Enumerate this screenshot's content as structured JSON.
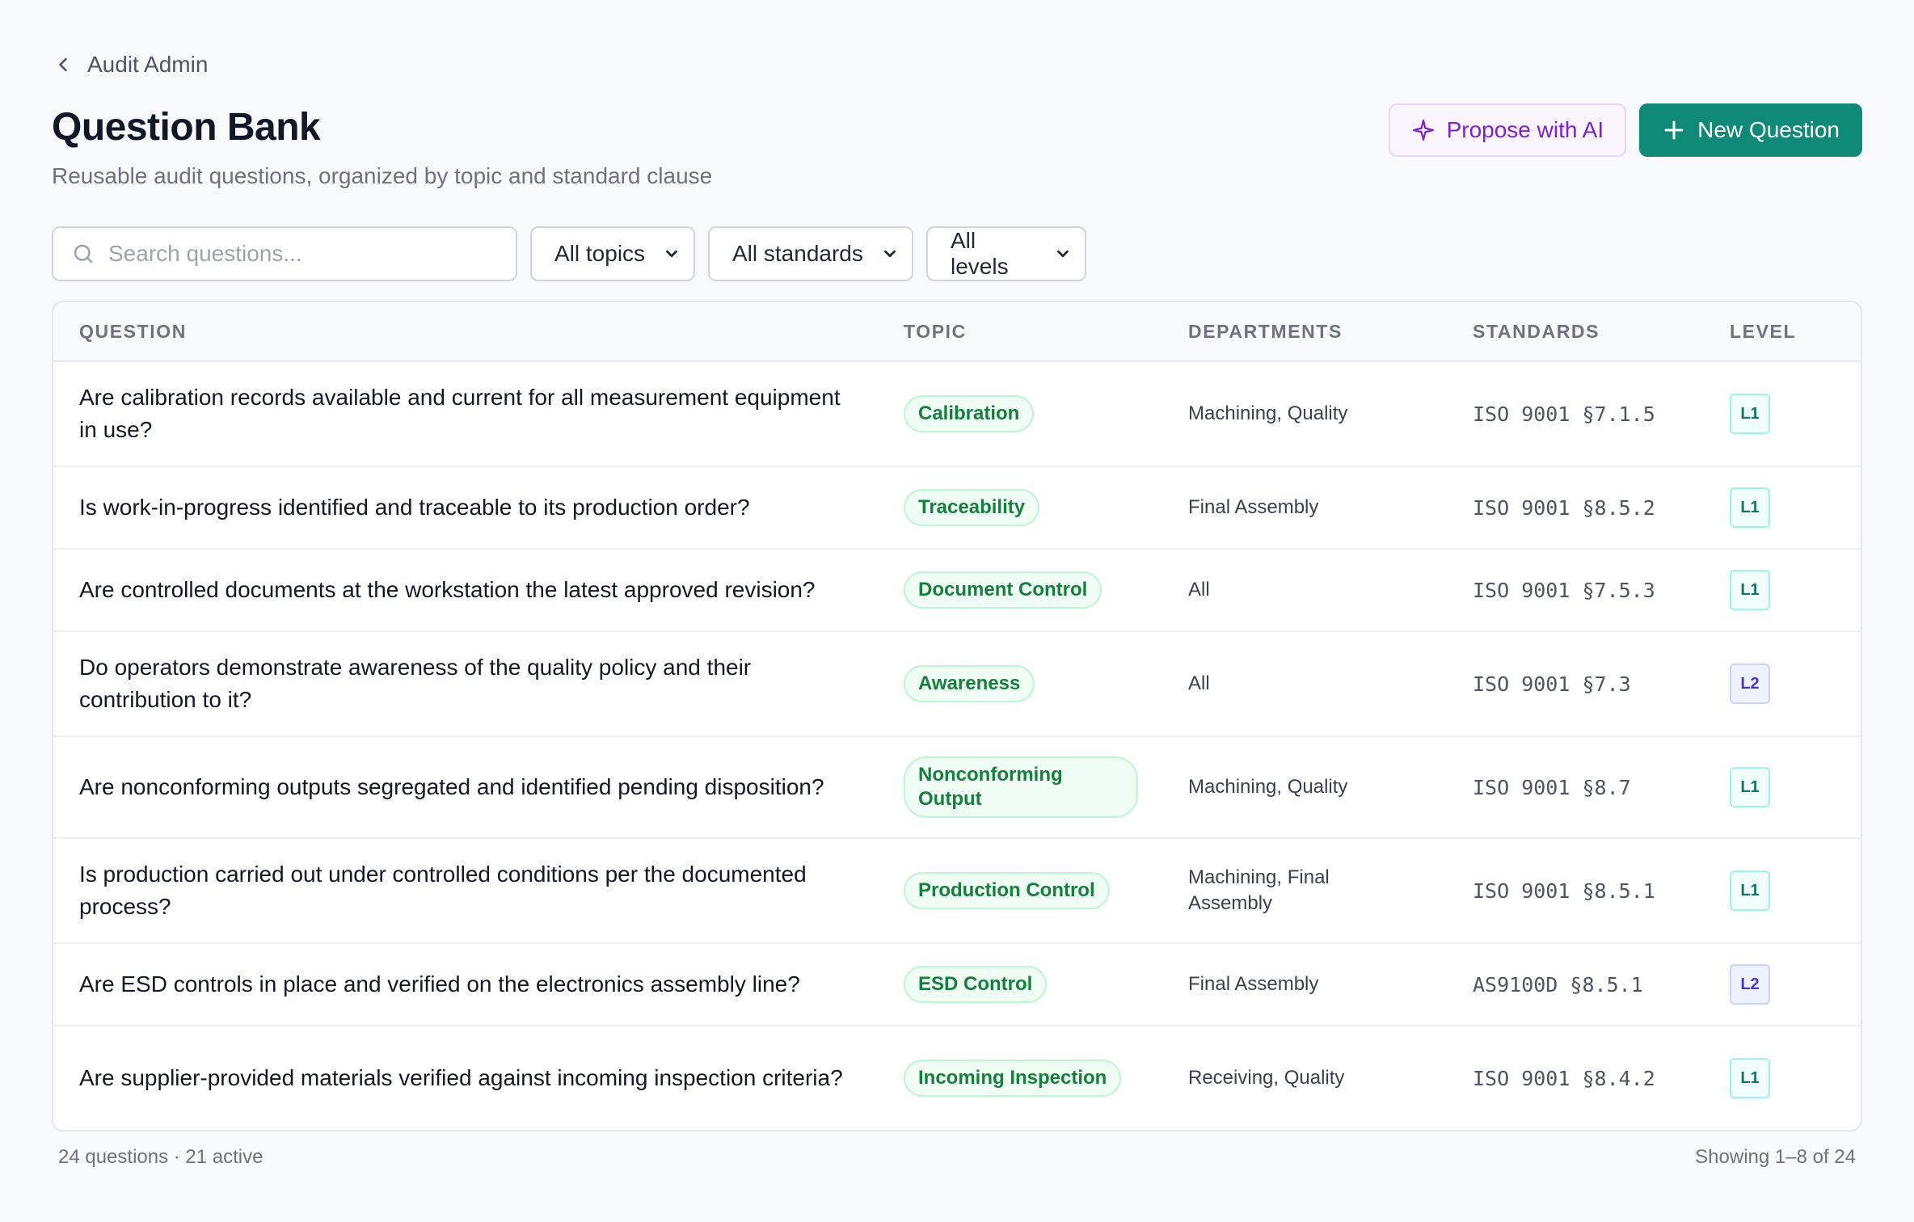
{
  "breadcrumb": {
    "label": "Audit Admin"
  },
  "header": {
    "title": "Question Bank",
    "subtitle": "Reusable audit questions, organized by topic and standard clause",
    "propose_label": "Propose with AI",
    "new_label": "New Question"
  },
  "filters": {
    "search_placeholder": "Search questions...",
    "topic": "All topics",
    "standard": "All standards",
    "level": "All levels"
  },
  "table": {
    "columns": {
      "question": "QUESTION",
      "topic": "TOPIC",
      "departments": "DEPARTMENTS",
      "standards": "STANDARDS",
      "level": "LEVEL"
    },
    "rows": [
      {
        "question": "Are calibration records available and current for all measurement equipment in use?",
        "topic": "Calibration",
        "departments": "Machining, Quality",
        "standard": "ISO 9001 §7.1.5",
        "level": "L1"
      },
      {
        "question": "Is work-in-progress identified and traceable to its production order?",
        "topic": "Traceability",
        "departments": "Final Assembly",
        "standard": "ISO 9001 §8.5.2",
        "level": "L1"
      },
      {
        "question": "Are controlled documents at the workstation the latest approved revision?",
        "topic": "Document Control",
        "departments": "All",
        "standard": "ISO 9001 §7.5.3",
        "level": "L1"
      },
      {
        "question": "Do operators demonstrate awareness of the quality policy and their contribution to it?",
        "topic": "Awareness",
        "departments": "All",
        "standard": "ISO 9001 §7.3",
        "level": "L2"
      },
      {
        "question": "Are nonconforming outputs segregated and identified pending disposition?",
        "topic": "Nonconforming Output",
        "departments": "Machining, Quality",
        "standard": "ISO 9001 §8.7",
        "level": "L1"
      },
      {
        "question": "Is production carried out under controlled conditions per the documented process?",
        "topic": "Production Control",
        "departments": "Machining, Final Assembly",
        "standard": "ISO 9001 §8.5.1",
        "level": "L1"
      },
      {
        "question": "Are ESD controls in place and verified on the electronics assembly line?",
        "topic": "ESD Control",
        "departments": "Final Assembly",
        "standard": "AS9100D §8.5.1",
        "level": "L2"
      },
      {
        "question": "Are supplier-provided materials verified against incoming inspection criteria?",
        "topic": "Incoming Inspection",
        "departments": "Receiving, Quality",
        "standard": "ISO 9001 §8.4.2",
        "level": "L1"
      }
    ]
  },
  "footer": {
    "summary": "24 questions · 21 active",
    "pagination": "Showing 1–8 of 24"
  },
  "colors": {
    "accent": "#0f8a78",
    "ai": "#7e22ce",
    "topic": "#15803d",
    "level_1": "#0f766e",
    "level_2": "#4338ca"
  },
  "icons": {
    "breadcrumb": "chevron-left-icon",
    "propose": "sparkle-icon",
    "new": "plus-icon",
    "search": "search-icon",
    "select": "chevron-down-icon"
  }
}
